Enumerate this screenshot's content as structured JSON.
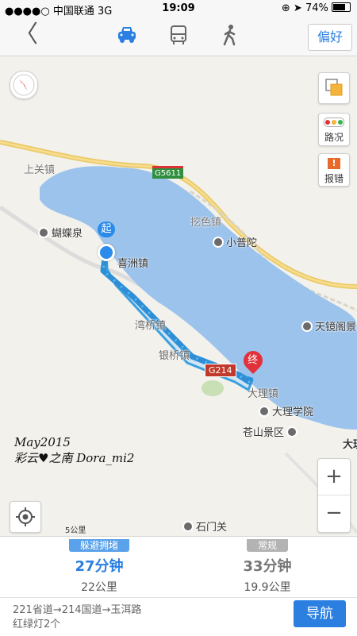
{
  "status_bar": {
    "carrier": "●●●●○ 中国联通 3G",
    "time": "19:09",
    "battery": "74%"
  },
  "top_bar": {
    "modes": [
      "car-icon",
      "bus-icon",
      "walk-icon"
    ],
    "active_mode": "car",
    "preference_label": "偏好"
  },
  "map": {
    "controls": {
      "traffic_label": "路况",
      "report_label": "报错"
    },
    "place_labels": {
      "shangguan": "上关镇",
      "butterfly_spring": "蝴蝶泉",
      "xizhou": "喜洲镇",
      "wanqiao": "湾桥镇",
      "yinqiao": "银桥镇",
      "wase": "挖色镇",
      "xiaoputuo": "小普陀",
      "tianjingge": "天镜阁景区",
      "dali_town": "大理镇",
      "dali_university": "大理学院",
      "cangshan": "苍山景区",
      "shimenguan": "石门关",
      "dali_partial": "大理"
    },
    "road_shields": {
      "g5611": "G5611",
      "g214": "G214"
    },
    "markers": {
      "start": "起",
      "end": "终"
    },
    "scale_label": "5公里",
    "watermark_line1": "May2015",
    "watermark_line2": "彩云♥之南 Dora_mi2",
    "zoom_in": "+",
    "zoom_out": "−"
  },
  "route_options": [
    {
      "tag": "躲避拥堵",
      "duration": "27分钟",
      "distance": "22公里",
      "selected": true
    },
    {
      "tag": "常规",
      "duration": "33分钟",
      "distance": "19.9公里",
      "selected": false
    }
  ],
  "route_summary": {
    "roads": "221省道→214国道→玉洱路",
    "lights": "红绿灯2个"
  },
  "nav_button_label": "导航",
  "colors": {
    "accent": "#2a7fe0",
    "lake": "#9cc3ec",
    "route_fill": "#3aa0e0",
    "end_marker": "#e2313a",
    "tag_selected": "#5aa2ea",
    "tag_unselected": "#b3b3b3"
  }
}
